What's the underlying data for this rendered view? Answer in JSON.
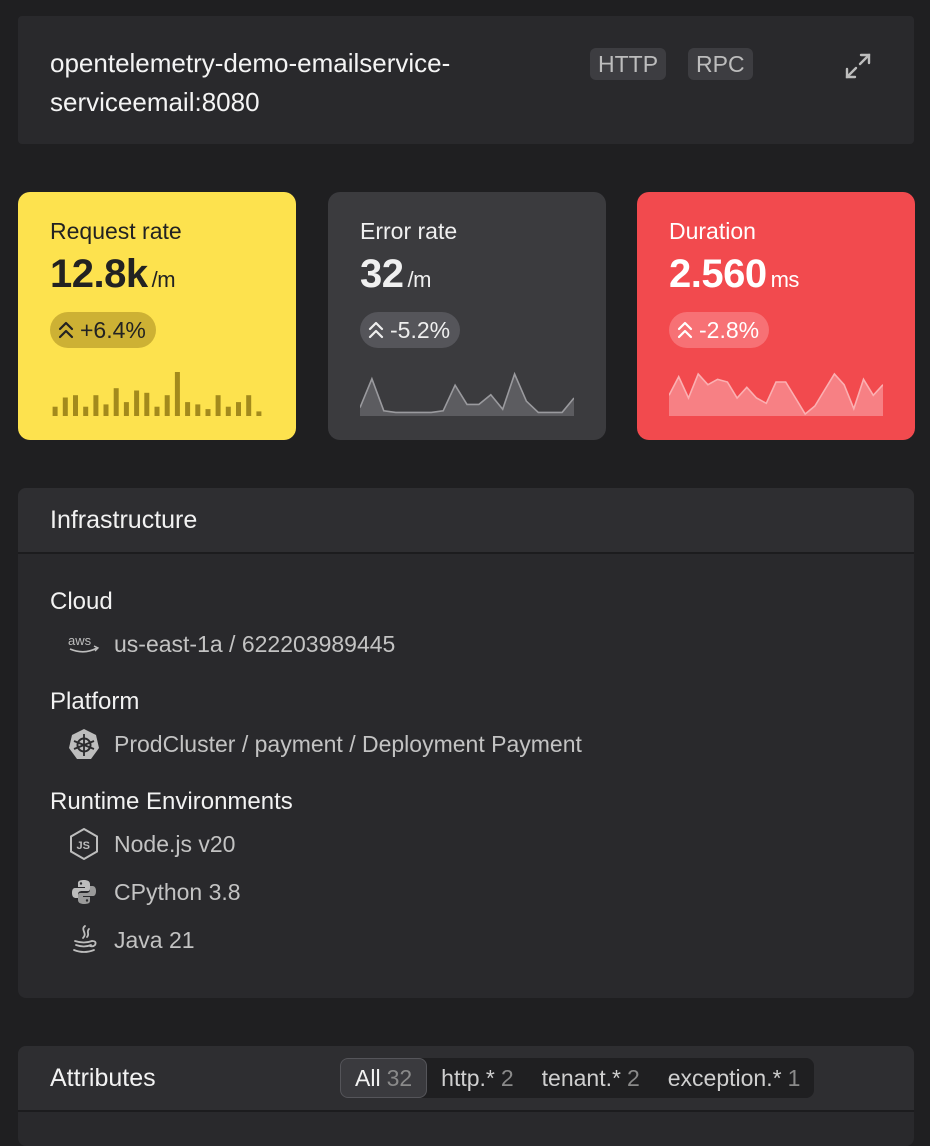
{
  "header": {
    "service_name": "opentelemetry-demo-emailservice-serviceemail:8080",
    "badges": [
      "HTTP",
      "RPC"
    ],
    "expand_icon": "expand-icon"
  },
  "metrics": [
    {
      "label": "Request rate",
      "value": "12.8k",
      "unit": "/m",
      "change": "+6.4%",
      "color": "#fde24e",
      "chart_data": {
        "type": "bar",
        "values": [
          4,
          8,
          9,
          4,
          9,
          5,
          12,
          6,
          11,
          10,
          4,
          9,
          19,
          6,
          5,
          3,
          9,
          4,
          6,
          9,
          2
        ]
      }
    },
    {
      "label": "Error rate",
      "value": "32",
      "unit": "/m",
      "change": "-5.2%",
      "color": "#3b3b3e",
      "chart_data": {
        "type": "line",
        "values": [
          4,
          22,
          2,
          1,
          1,
          1,
          1,
          2,
          18,
          6,
          6,
          12,
          3,
          25,
          8,
          1,
          1,
          1,
          10
        ]
      }
    },
    {
      "label": "Duration",
      "value": "2.560",
      "unit": "ms",
      "change": "-2.8%",
      "color": "#f24a4e",
      "chart_data": {
        "type": "area",
        "values": [
          14,
          28,
          12,
          30,
          22,
          26,
          24,
          12,
          20,
          12,
          8,
          24,
          24,
          12,
          0,
          6,
          18,
          30,
          22,
          4,
          26,
          14,
          22
        ]
      }
    }
  ],
  "infrastructure": {
    "title": "Infrastructure",
    "cloud": {
      "title": "Cloud",
      "icon": "aws-icon",
      "value": "us-east-1a / 622203989445"
    },
    "platform": {
      "title": "Platform",
      "icon": "kubernetes-icon",
      "value": "ProdCluster / payment / Deployment Payment"
    },
    "runtime": {
      "title": "Runtime Environments",
      "items": [
        {
          "icon": "nodejs-icon",
          "label": "Node.js v20"
        },
        {
          "icon": "python-icon",
          "label": "CPython 3.8"
        },
        {
          "icon": "java-icon",
          "label": "Java 21"
        }
      ]
    }
  },
  "attributes": {
    "title": "Attributes",
    "filters": [
      {
        "label": "All",
        "count": "32",
        "active": true
      },
      {
        "label": "http.*",
        "count": "2"
      },
      {
        "label": "tenant.*",
        "count": "2"
      },
      {
        "label": "exception.*",
        "count": "1"
      }
    ]
  }
}
